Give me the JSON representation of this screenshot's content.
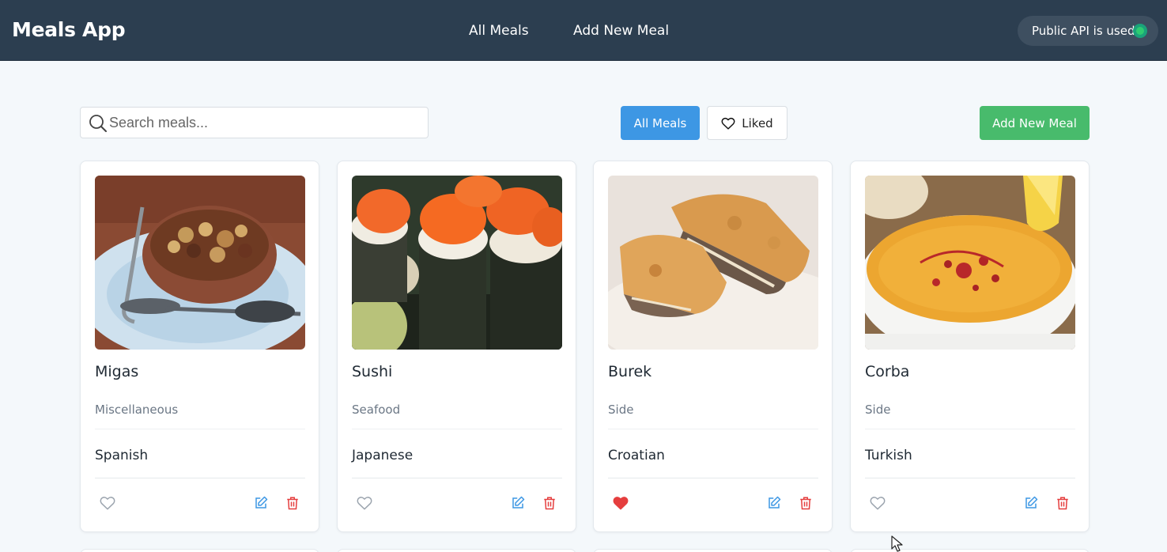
{
  "navbar": {
    "brand": "Meals App",
    "links": [
      "All Meals",
      "Add New Meal"
    ],
    "api_status": "Public API is used",
    "api_status_color": "#2ecc71"
  },
  "toolbar": {
    "search_placeholder": "Search meals...",
    "search_value": "",
    "filter_all": "All Meals",
    "filter_liked": "Liked",
    "active_filter": "All Meals",
    "add_button": "Add New Meal"
  },
  "colors": {
    "navbar_bg": "#2c3e50",
    "primary": "#3d97e4",
    "success": "#48bb6c",
    "danger": "#e53e3e",
    "edit": "#3d97e4"
  },
  "meals": [
    {
      "name": "Migas",
      "category": "Miscellaneous",
      "area": "Spanish",
      "liked": false,
      "image_icon": "migas-photo"
    },
    {
      "name": "Sushi",
      "category": "Seafood",
      "area": "Japanese",
      "liked": false,
      "image_icon": "sushi-photo"
    },
    {
      "name": "Burek",
      "category": "Side",
      "area": "Croatian",
      "liked": true,
      "image_icon": "burek-photo"
    },
    {
      "name": "Corba",
      "category": "Side",
      "area": "Turkish",
      "liked": false,
      "image_icon": "corba-photo"
    }
  ]
}
